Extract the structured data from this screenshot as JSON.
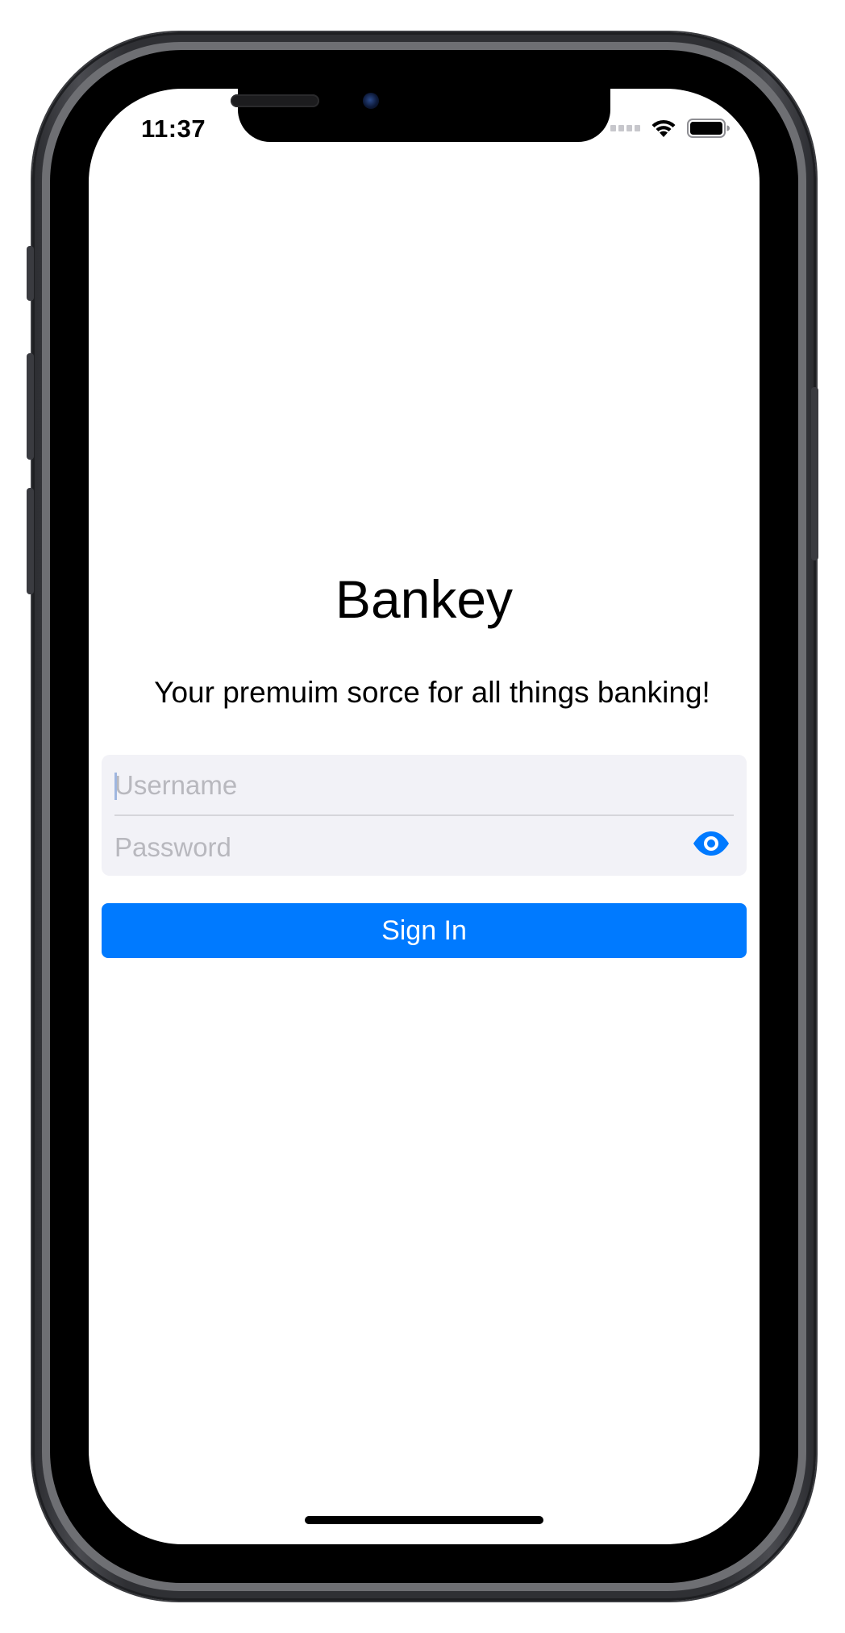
{
  "status_bar": {
    "time": "11:37",
    "icons": [
      "cellular-signal-icon",
      "wifi-icon",
      "battery-icon"
    ]
  },
  "app": {
    "title": "Bankey",
    "subtitle": "Your premuim sorce for all things banking!"
  },
  "login_form": {
    "username": {
      "value": "",
      "placeholder": "Username"
    },
    "password": {
      "value": "",
      "placeholder": "Password",
      "toggle_icon": "eye-icon"
    }
  },
  "sign_in_button": {
    "label": "Sign In"
  },
  "colors": {
    "accent": "#007aff",
    "form_background": "#f2f2f7",
    "placeholder": "#b8b8be"
  }
}
